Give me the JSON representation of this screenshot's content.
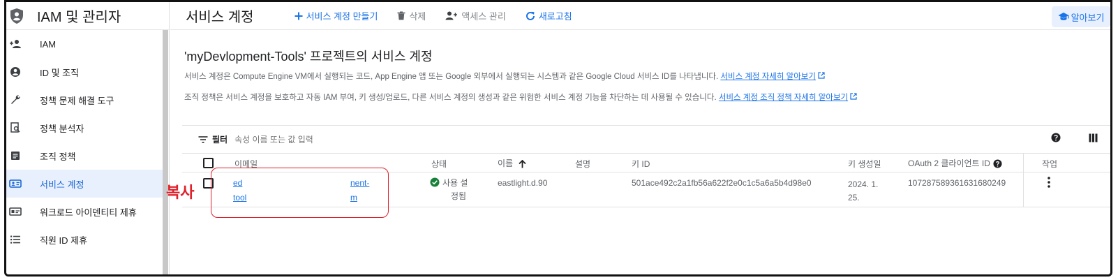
{
  "sidebar": {
    "title": "IAM 및 관리자",
    "items": [
      {
        "label": "IAM",
        "icon": "person-add-icon"
      },
      {
        "label": "ID 및 조직",
        "icon": "account-circle-icon"
      },
      {
        "label": "정책 문제 해결 도구",
        "icon": "wrench-icon"
      },
      {
        "label": "정책 분석자",
        "icon": "policy-search-icon"
      },
      {
        "label": "조직 정책",
        "icon": "document-icon"
      },
      {
        "label": "서비스 계정",
        "icon": "service-account-icon",
        "active": true
      },
      {
        "label": "워크로드 아이덴티티 제휴",
        "icon": "id-card-icon"
      },
      {
        "label": "직원 ID 제휴",
        "icon": "list-icon"
      }
    ]
  },
  "topbar": {
    "title": "서비스 계정",
    "create_label": "서비스 계정 만들기",
    "delete_label": "삭제",
    "manage_access_label": "액세스 관리",
    "refresh_label": "새로고침",
    "learn_label": "알아보기"
  },
  "content": {
    "heading": "'myDevlopment-Tools' 프로젝트의 서비스 계정",
    "desc1": "서비스 계정은 Compute Engine VM에서 실행되는 코드, App Engine 앱 또는 Google 외부에서 실행되는 시스템과 같은 Google Cloud 서비스 ID를 나타냅니다.",
    "desc1_link": "서비스 계정 자세히 알아보기",
    "desc2": "조직 정책은 서비스 계정을 보호하고 자동 IAM 부여, 키 생성/업로드, 다른 서비스 계정의 생성과 같은 위험한 서비스 계정 기능을 차단하는 데 사용될 수 있습니다.",
    "desc2_link": "서비스 계정 조직 정책 자세히 알아보기"
  },
  "filter": {
    "label": "필터",
    "placeholder": "속성 이름 또는 값 입력"
  },
  "table": {
    "headers": {
      "email": "이메일",
      "status": "상태",
      "name": "이름",
      "description": "설명",
      "key_id": "키 ID",
      "key_created": "키 생성일",
      "oauth_id": "OAuth 2 클라이언트 ID",
      "actions": "작업"
    },
    "rows": [
      {
        "email_part1": "ed",
        "email_part2": "nent-",
        "email_part3": "tool",
        "email_part4": "m",
        "status_line1": "사용 설",
        "status_line2": "정됨",
        "name": "eastlight.d.90",
        "description": "",
        "key_id": "501ace492c2a1fb56a622f2e0c1c5a6a5b4d98e0",
        "key_created_line1": "2024. 1.",
        "key_created_line2": "25.",
        "oauth_id": "107287589361631680249"
      }
    ]
  },
  "annotation": {
    "copy_label": "복사"
  },
  "colors": {
    "accent": "#1a73e8",
    "highlight": "#e0202a",
    "active_bg": "#e8f0fe",
    "ok_green": "#188038"
  }
}
